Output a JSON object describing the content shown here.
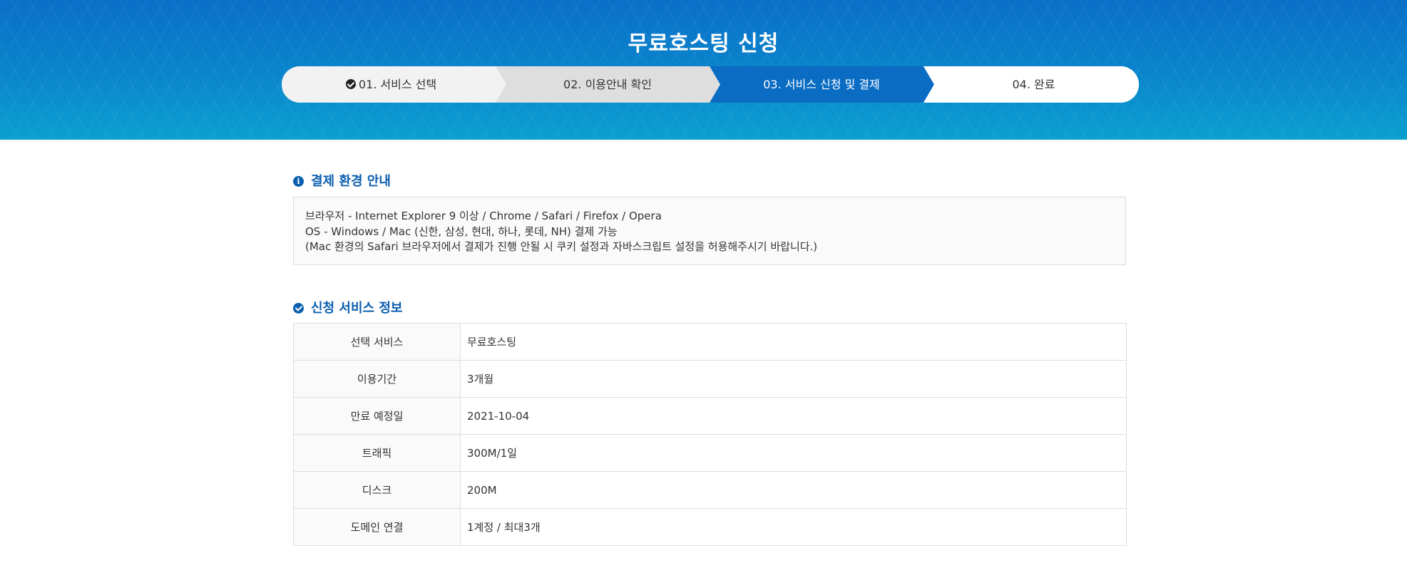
{
  "header": {
    "title": "무료호스팅 신청"
  },
  "steps": [
    {
      "label": "01. 서비스 선택",
      "state": "done",
      "icon": "check-circle-icon"
    },
    {
      "label": "02. 이용안내 확인",
      "state": "passed"
    },
    {
      "label": "03. 서비스 신청 및 결제",
      "state": "current"
    },
    {
      "label": "04. 완료",
      "state": "pending"
    }
  ],
  "colors": {
    "brand_blue": "#0b5fae",
    "current_step": "#0a6cc3",
    "done_step": "#f2f2f2",
    "passed_step": "#dedede"
  },
  "payment_env": {
    "icon": "info-circle-icon",
    "title": "결제 환경 안내",
    "lines": [
      "브라우저 - Internet Explorer 9 이상 / Chrome / Safari / Firefox / Opera",
      "OS - Windows / Mac (신한, 삼성, 현대, 하나, 롯데, NH) 결제 가능",
      "(Mac 환경의 Safari 브라우저에서 결제가 진행 안될 시 쿠키 설정과 자바스크립트 설정을 허용해주시기 바랍니다.)"
    ]
  },
  "service_info": {
    "icon": "check-circle-icon",
    "title": "신청 서비스 정보",
    "rows": [
      {
        "label": "선택 서비스",
        "value": "무료호스팅"
      },
      {
        "label": "이용기간",
        "value": "3개월"
      },
      {
        "label": "만료 예정일",
        "value": "2021-10-04"
      },
      {
        "label": "트래픽",
        "value": "300M/1일"
      },
      {
        "label": "디스크",
        "value": "200M"
      },
      {
        "label": "도메인 연결",
        "value": "1계정 / 최대3개"
      }
    ]
  }
}
